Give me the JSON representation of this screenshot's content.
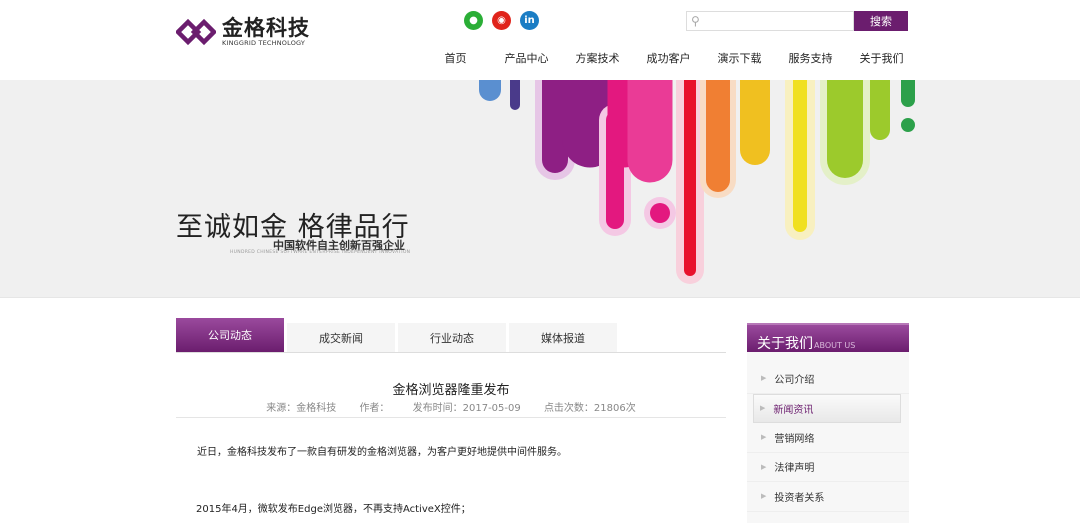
{
  "header": {
    "logo_cn": "金格科技",
    "logo_en": "KINGGRID TECHNOLOGY",
    "social": [
      {
        "icon": "wechat-icon",
        "glyph": "●",
        "color": "#2aae36"
      },
      {
        "icon": "weibo-icon",
        "glyph": "◉",
        "color": "#e0241b"
      },
      {
        "icon": "linkedin-icon",
        "glyph": "in",
        "color": "#1b7dc4"
      }
    ],
    "search_placeholder": "",
    "search_button": "搜索",
    "nav": [
      "首页",
      "产品中心",
      "方案技术",
      "成功客户",
      "演示下载",
      "服务支持",
      "关于我们"
    ]
  },
  "banner": {
    "slogan": "至诚如金 格律品行",
    "subtitle": "中国软件自主创新百强企业",
    "subtitle_en": "HUNDRED CHINESE SOFTWARE ENTERPRISE INDEPENDENT INNOVATION"
  },
  "tabs": [
    "公司动态",
    "成交新闻",
    "行业动态",
    "媒体报道"
  ],
  "article": {
    "title": "金格浏览器隆重发布",
    "source": "来源：金格科技",
    "author": "作者：",
    "date": "发布时间：2017-05-09",
    "views": "点击次数：21806次",
    "p1": "近日，金格科技发布了一款自有研发的金格浏览器，为客户更好地提供中间件服务。",
    "p2": "2015年4月，微软发布Edge浏览器，不再支持ActiveX控件；"
  },
  "sidebar": {
    "title": "关于我们",
    "title_en": "ABOUT US",
    "items": [
      "公司介绍",
      "新闻资讯",
      "营销网络",
      "法律声明",
      "投资者关系"
    ]
  }
}
